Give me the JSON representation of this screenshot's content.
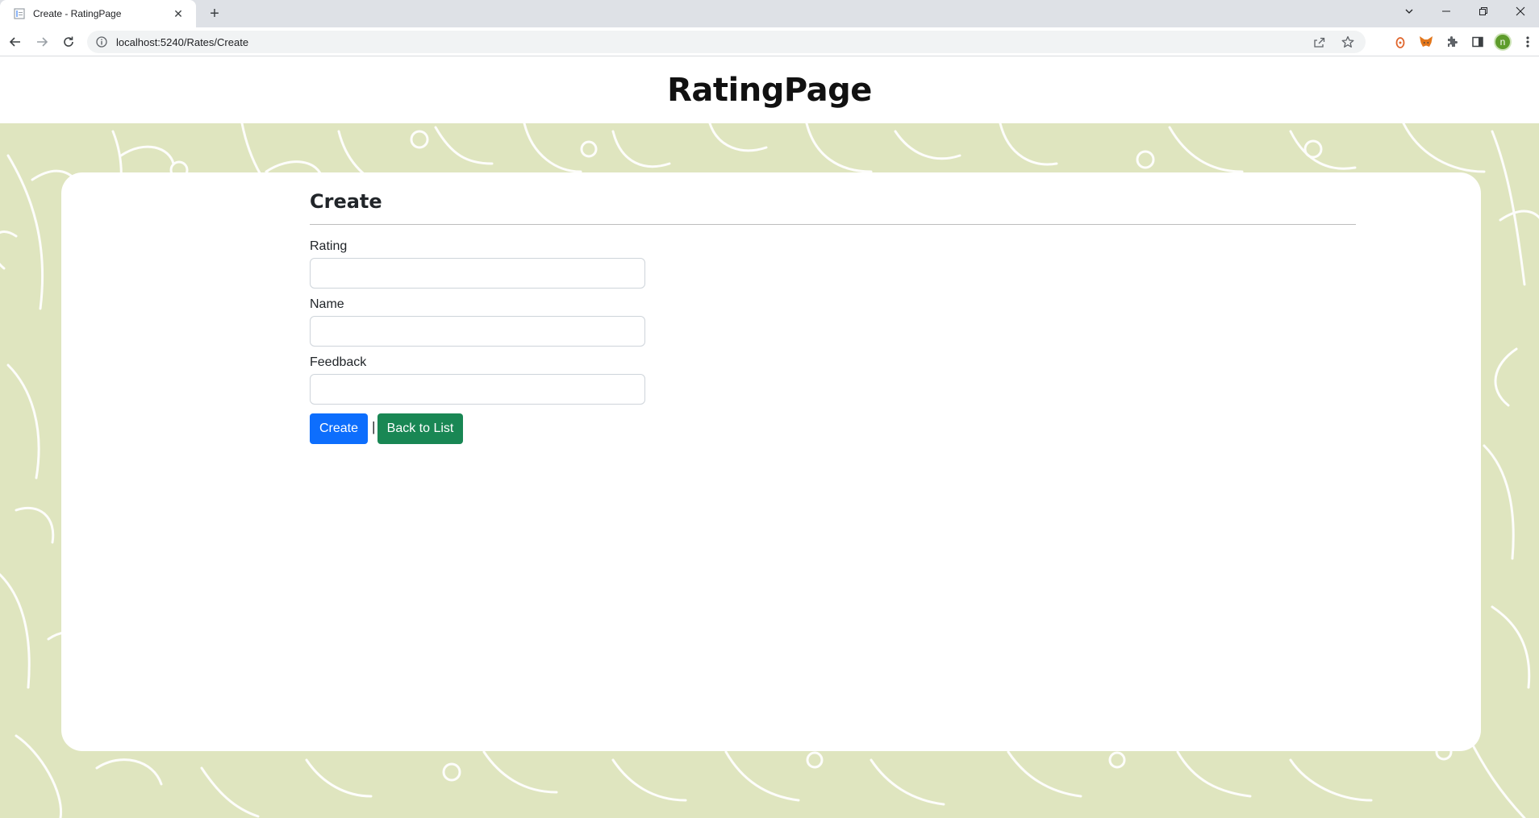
{
  "browser": {
    "tab_title": "Create - RatingPage",
    "url": "localhost:5240/Rates/Create",
    "profile_initial": "n"
  },
  "header": {
    "site_title": "RatingPage"
  },
  "form": {
    "heading": "Create",
    "fields": [
      {
        "label": "Rating",
        "value": "",
        "placeholder": ""
      },
      {
        "label": "Name",
        "value": "",
        "placeholder": ""
      },
      {
        "label": "Feedback",
        "value": "",
        "placeholder": ""
      }
    ],
    "create_label": "Create",
    "separator": "|",
    "back_label": "Back to List"
  },
  "colors": {
    "background_pattern": "#dfe5bf",
    "primary_button": "#0d6efd",
    "success_button": "#198754"
  }
}
